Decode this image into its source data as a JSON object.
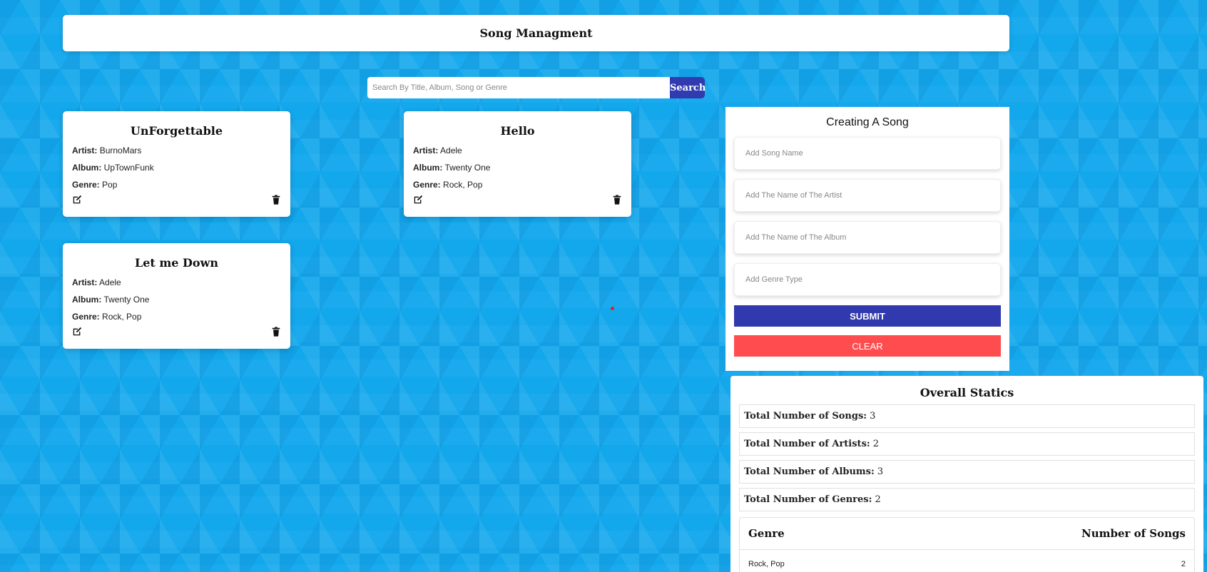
{
  "header": {
    "title": "Song Managment"
  },
  "search": {
    "placeholder": "Search By Title, Album, Song or Genre",
    "button_label": "Search"
  },
  "labels": {
    "artist": "Artist:",
    "album": "Album:",
    "genre": "Genre:"
  },
  "songs": [
    {
      "title": "UnForgettable",
      "artist": "BurnoMars",
      "album": "UpTownFunk",
      "genre": "Pop"
    },
    {
      "title": "Hello",
      "artist": "Adele",
      "album": "Twenty One",
      "genre": "Rock, Pop"
    },
    {
      "title": "Let me Down",
      "artist": "Adele",
      "album": "Twenty One",
      "genre": "Rock, Pop"
    }
  ],
  "form": {
    "title": "Creating A Song",
    "song_name_placeholder": "Add Song Name",
    "artist_placeholder": "Add The Name of The Artist",
    "album_placeholder": "Add The Name of The Album",
    "genre_placeholder": "Add Genre Type",
    "submit_label": "SUBMIT",
    "clear_label": "CLEAR"
  },
  "stats": {
    "title": "Overall Statics",
    "rows": [
      {
        "label": "Total Number of Songs:",
        "value": "3"
      },
      {
        "label": "Total Number of Artists:",
        "value": "2"
      },
      {
        "label": "Total Number of Albums:",
        "value": "3"
      },
      {
        "label": "Total Number of Genres:",
        "value": "2"
      }
    ],
    "table": {
      "col_genre": "Genre",
      "col_count": "Number of Songs",
      "rows": [
        {
          "genre": "Rock, Pop",
          "count": "2"
        }
      ]
    }
  },
  "colors": {
    "background": "#13a7ec",
    "primary": "#303bb0",
    "danger": "#ff4d4f"
  },
  "icons": {
    "edit": "edit-icon",
    "delete": "trash-icon"
  }
}
